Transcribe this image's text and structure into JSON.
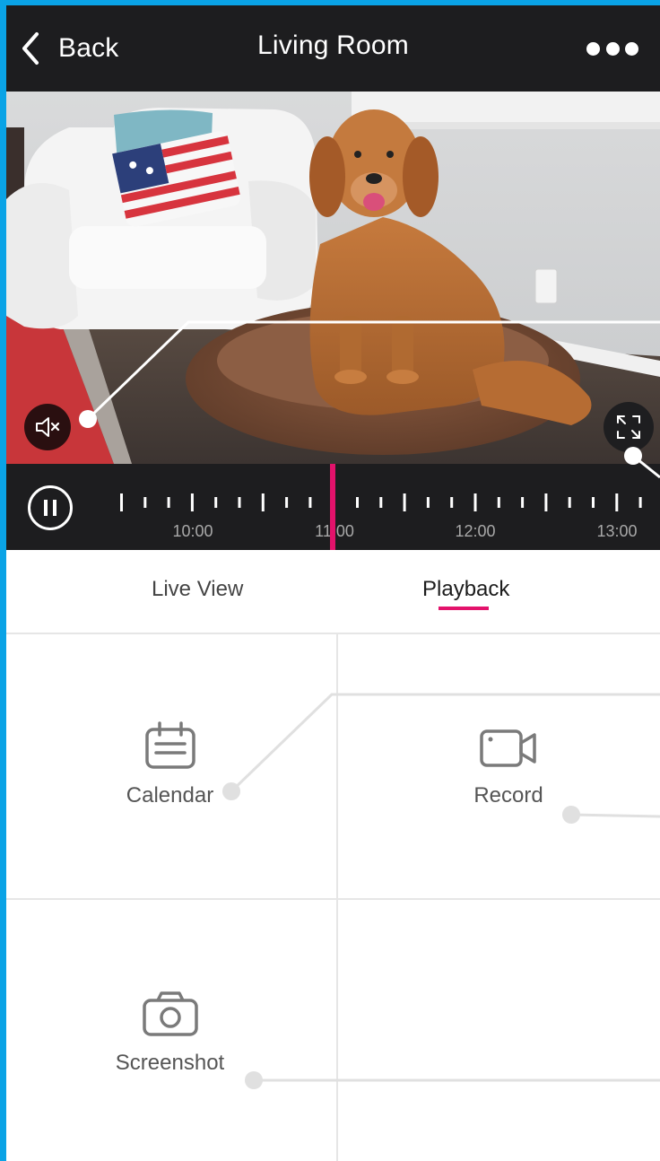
{
  "header": {
    "back_label": "Back",
    "title": "Living Room",
    "more_icon": "more-dots-icon"
  },
  "video": {
    "mute_icon": "speaker-muted-icon",
    "fullscreen_icon": "fullscreen-icon"
  },
  "timeline": {
    "pause_icon": "pause-icon",
    "labels": [
      "10:00",
      "11:00",
      "12:00",
      "13:00"
    ],
    "accent_color": "#e3126b"
  },
  "tabs": [
    {
      "label": "Live View",
      "active": false
    },
    {
      "label": "Playback",
      "active": true
    }
  ],
  "actions": {
    "calendar_label": "Calendar",
    "record_label": "Record",
    "screenshot_label": "Screenshot"
  },
  "colors": {
    "bar": "#1d1d1f",
    "accent": "#e3126b",
    "frame": "#0aa3e6"
  }
}
